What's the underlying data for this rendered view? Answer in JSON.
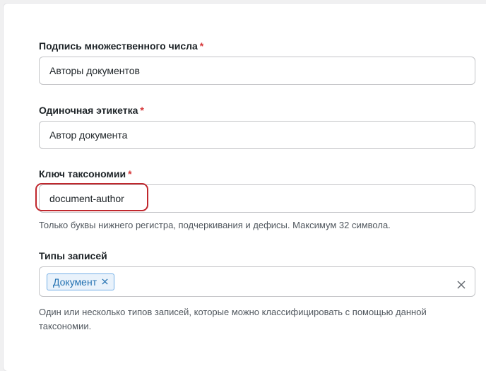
{
  "form": {
    "plural_label": {
      "label": "Подпись множественного числа",
      "required_mark": "*",
      "value": "Авторы документов"
    },
    "singular_label": {
      "label": "Одиночная этикетка",
      "required_mark": "*",
      "value": "Автор документа"
    },
    "taxonomy_key": {
      "label": "Ключ таксономии",
      "required_mark": "*",
      "value": "document-author",
      "help": "Только буквы нижнего регистра, подчеркивания и дефисы. Максимум 32 символа."
    },
    "post_types": {
      "label": "Типы записей",
      "tags": [
        "Документ"
      ],
      "tag_remove_icon": "close-icon",
      "clear_icon": "close-icon",
      "help": "Один или несколько типов записей, которые можно классифицировать с помощью данной таксономии."
    }
  },
  "colors": {
    "required": "#d63638",
    "highlight": "#c0272d",
    "tag_text": "#2271b1",
    "tag_bg": "#e9f2fb"
  }
}
